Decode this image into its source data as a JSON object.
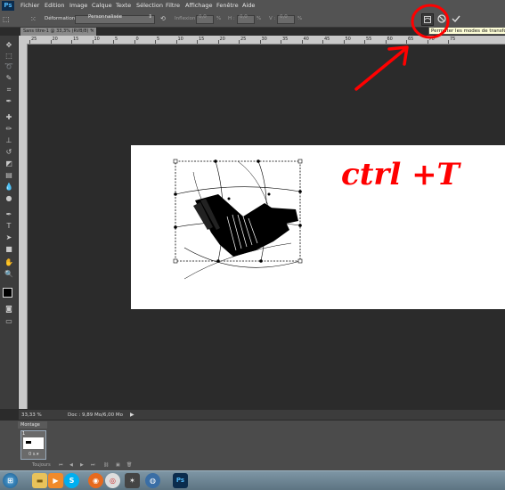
{
  "menubar": {
    "logo": "Ps",
    "items": [
      "Fichier",
      "Edition",
      "Image",
      "Calque",
      "Texte",
      "Sélection",
      "Filtre",
      "Affichage",
      "Fenêtre",
      "Aide"
    ]
  },
  "options": {
    "deformation_label": "Déformation :",
    "deformation_value": "Personnalisée",
    "inflexion_label": "Inflexion :",
    "inflexion_value": "0,0",
    "percent": "%",
    "h_label": "H :",
    "h_value": "0,0",
    "v_label": "V :",
    "v_value": "0,0"
  },
  "document": {
    "tab_title": "Sans titre-1 @ 33,3% (RVB/8) *",
    "close": "×"
  },
  "tooltip": "Permuter les modes de transformation",
  "ruler": {
    "top_labels": [
      "25",
      "20",
      "15",
      "10",
      "5",
      "0",
      "5",
      "10",
      "15",
      "20",
      "25",
      "30",
      "35",
      "40",
      "45",
      "50",
      "55",
      "60",
      "65",
      "70",
      "75"
    ]
  },
  "status": {
    "zoom": "33,33 %",
    "doc": "Doc : 9,89 Mo/6,00 Mo"
  },
  "timeline": {
    "tab": "Montage",
    "frame_number": "1",
    "frame_duration": "0 s.▾",
    "loop": "Toujours",
    "controls": [
      "⏮",
      "◀",
      "▶",
      "⏭",
      "⛓",
      "▣",
      "🗑"
    ]
  },
  "annotation": {
    "text": "ctrl +T",
    "color": "#ff0000"
  },
  "colors": {
    "accent_red": "#ff0000",
    "ui_dark": "#2b2b2b",
    "ui_mid": "#535353",
    "tooltip_bg": "#fdfdd6"
  },
  "taskbar": {
    "icons": [
      "start-orb-icon",
      "explorer-folder-icon",
      "media-player-icon",
      "skype-icon",
      "firefox-icon",
      "chrome-icon",
      "app-icon",
      "network-icon",
      "photoshop-icon"
    ]
  }
}
